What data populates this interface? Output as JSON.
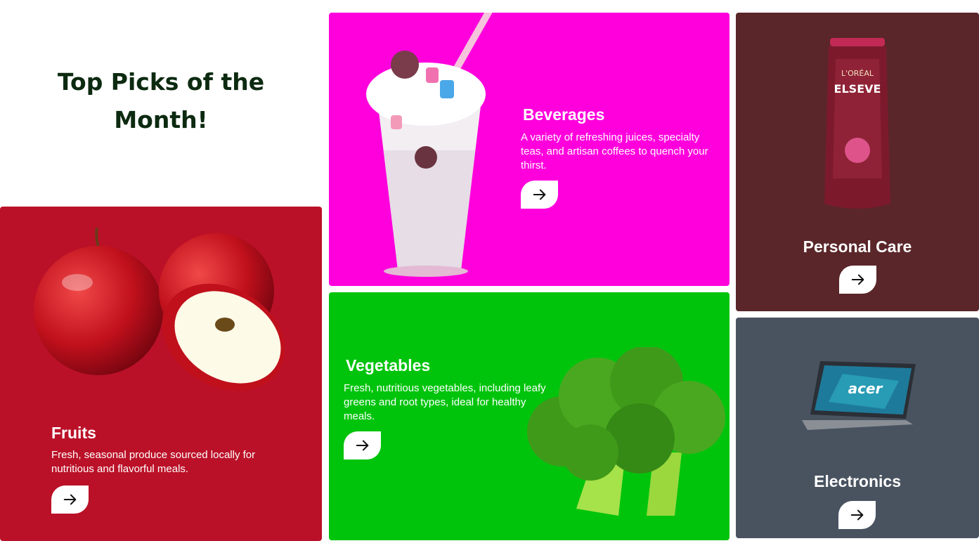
{
  "heading": {
    "line1": "Top Picks of the",
    "line2": "Month!"
  },
  "cards": {
    "fruits": {
      "title": "Fruits",
      "description": "Fresh, seasonal produce sourced locally for nutritious and flavorful meals.",
      "bg": "#bb1128"
    },
    "beverages": {
      "title": "Beverages",
      "description": "A variety of refreshing juices, specialty teas, and artisan coffees to quench your thirst.",
      "bg": "#ff00dd"
    },
    "vegetables": {
      "title": "Vegetables",
      "description": "Fresh, nutritious vegetables, including leafy greens and root types, ideal for healthy meals.",
      "bg": "#00c40c"
    },
    "personal_care": {
      "title": "Personal Care",
      "bg": "#5a2629",
      "product_brand": "L'ORÉAL",
      "product_name": "ELSEVE"
    },
    "electronics": {
      "title": "Electronics",
      "bg": "#495360",
      "product_brand": "acer"
    }
  },
  "icons": {
    "arrow": "arrow-right-icon"
  }
}
